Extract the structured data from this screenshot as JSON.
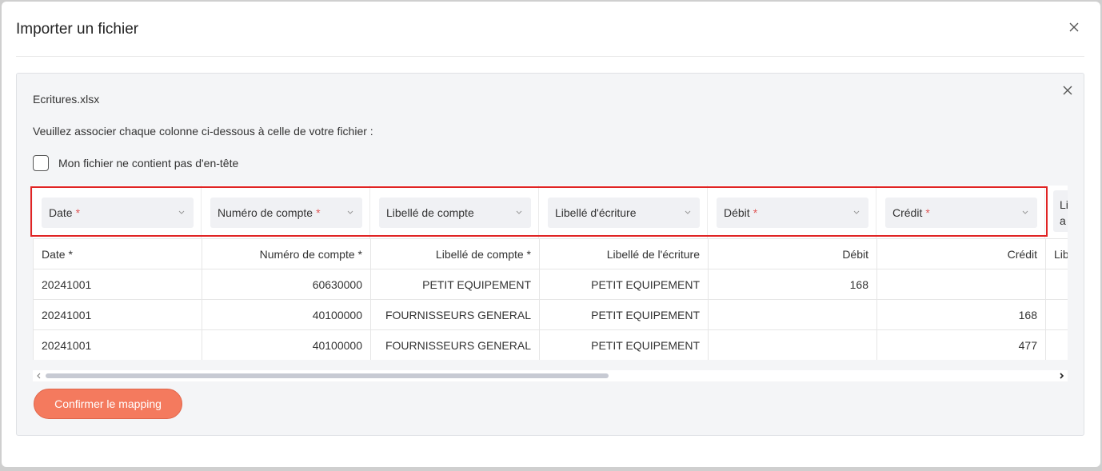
{
  "modal": {
    "title": "Importer un fichier"
  },
  "panel": {
    "file_name": "Ecritures.xlsx",
    "instruction": "Veuillez associer chaque colonne ci-dessous à celle de votre fichier :",
    "no_header_label": "Mon fichier ne contient pas d'en-tête",
    "no_header_checked": false
  },
  "mapping": [
    {
      "label": "Date",
      "required": "*"
    },
    {
      "label": "Numéro de compte",
      "required": "*"
    },
    {
      "label": "Libellé de compte",
      "required": ""
    },
    {
      "label": "Libellé d'écriture",
      "required": ""
    },
    {
      "label": "Débit",
      "required": "*"
    },
    {
      "label": "Crédit",
      "required": "*"
    }
  ],
  "mapping_partial": {
    "line1": "Li",
    "line2": "a"
  },
  "table": {
    "headers": [
      "Date *",
      "Numéro de compte *",
      "Libellé de compte *",
      "Libellé de l'écriture",
      "Débit",
      "Crédit",
      "Lib"
    ],
    "rows": [
      [
        "20241001",
        "60630000",
        "PETIT EQUIPEMENT",
        "PETIT EQUIPEMENT",
        "168",
        "",
        ""
      ],
      [
        "20241001",
        "40100000",
        "FOURNISSEURS GENERAL",
        "PETIT EQUIPEMENT",
        "",
        "168",
        ""
      ],
      [
        "20241001",
        "40100000",
        "FOURNISSEURS GENERAL",
        "PETIT EQUIPEMENT",
        "",
        "477",
        ""
      ]
    ]
  },
  "actions": {
    "confirm_label": "Confirmer le mapping"
  },
  "colors": {
    "accent": "#f47a5e",
    "required": "#e05656",
    "highlight": "#e02424"
  }
}
